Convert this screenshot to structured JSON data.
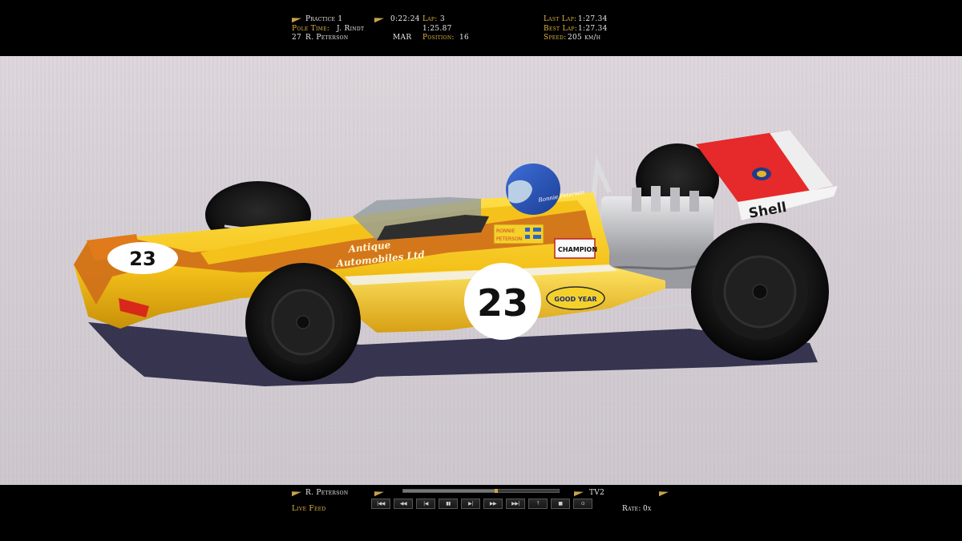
{
  "hud_top": {
    "session": "Practice 1",
    "session_time": "0:22:24",
    "lap_label": "Lap:",
    "lap_value": "3",
    "pole_label": "Pole Time:",
    "pole_driver": "J. Rindt",
    "pole_time": "1:25.87",
    "car_number": "27",
    "driver": "R. Peterson",
    "team": "MAR",
    "position_label": "Position:",
    "position_value": "16",
    "last_lap_label": "Last Lap:",
    "last_lap_value": "1:27.34",
    "best_lap_label": "Best Lap:",
    "best_lap_value": "1:27.34",
    "speed_label": "Speed:",
    "speed_value": "205 km/h"
  },
  "car": {
    "number": "23",
    "sponsor_line1": "Antique",
    "sponsor_line2": "Automobiles Ltd",
    "tyre_brand": "GOOD YEAR",
    "plug_brand": "CHAMPION",
    "fuel_brand": "Shell",
    "driver_name_line1": "RONNIE",
    "driver_name_line2": "PETERSON",
    "helmet_script": "Ronnie Peterson"
  },
  "hud_bottom": {
    "driver": "R. Peterson",
    "camera": "TV2",
    "feed": "Live Feed",
    "rate_label": "Rate:",
    "rate_value": "0x",
    "progress": 0.6,
    "controls": [
      "|◀◀",
      "◀◀",
      "|◀",
      "▮▮",
      "▶|",
      "▶▶",
      "▶▶|",
      "⤒",
      "■",
      "⊙"
    ]
  }
}
